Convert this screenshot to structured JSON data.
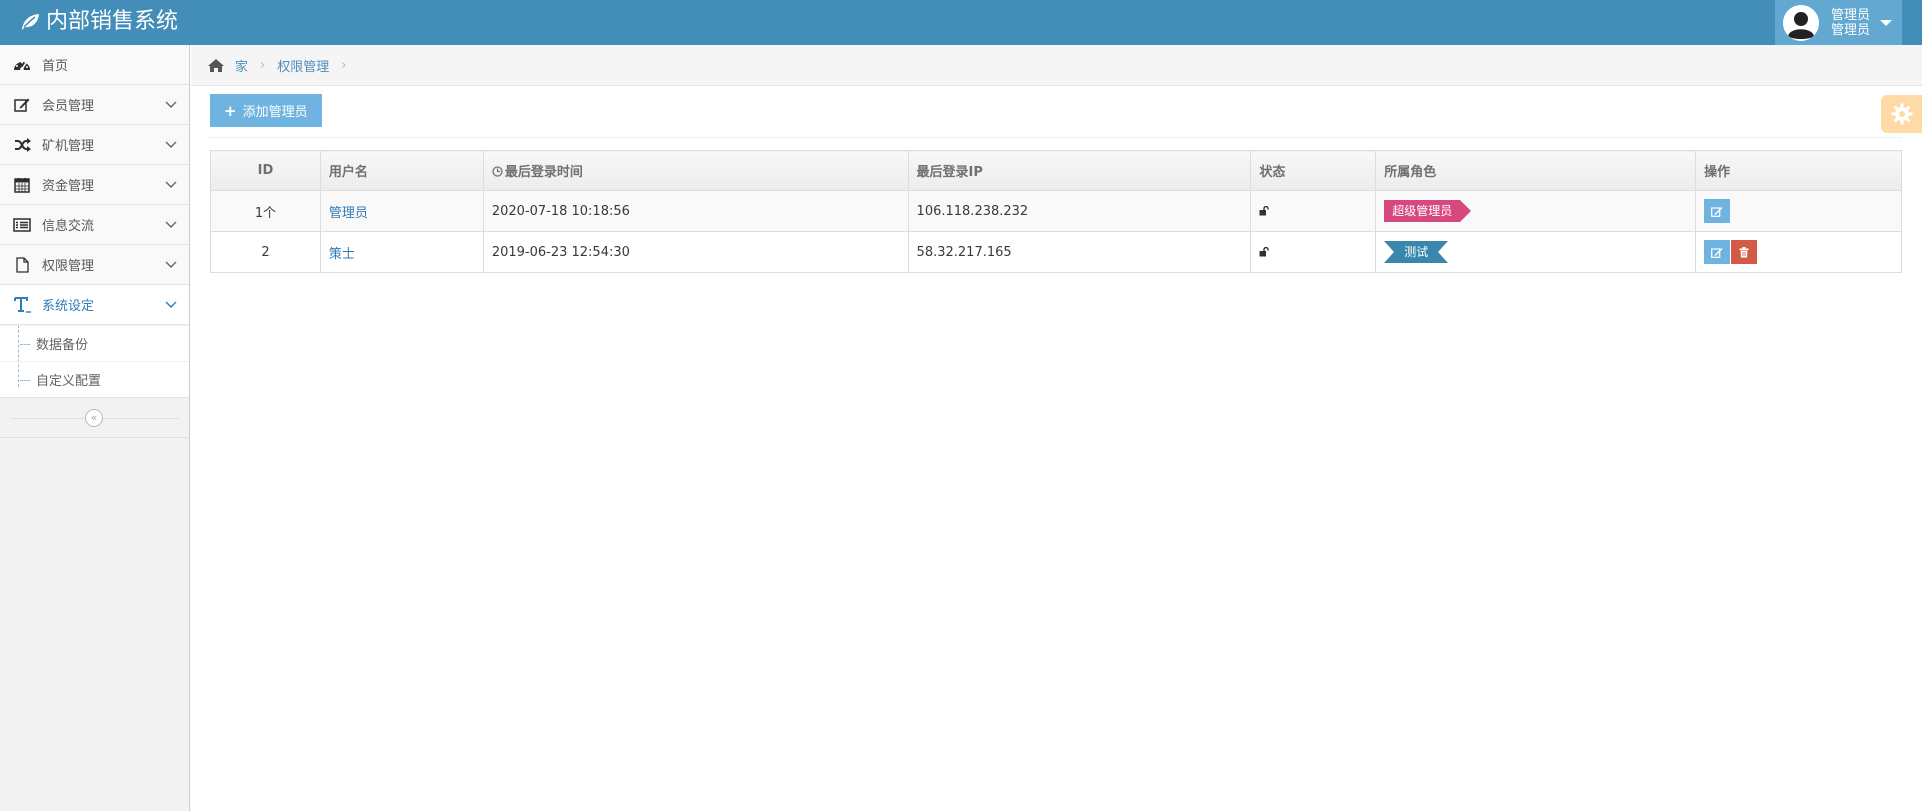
{
  "app": {
    "title": "内部销售系统"
  },
  "user": {
    "line1": "管理员",
    "line2": "管理员"
  },
  "sidebar": {
    "items": [
      {
        "label": "首页",
        "icon": "dashboard-icon"
      },
      {
        "label": "会员管理",
        "icon": "edit-icon"
      },
      {
        "label": "矿机管理",
        "icon": "random-icon"
      },
      {
        "label": "资金管理",
        "icon": "calendar-icon"
      },
      {
        "label": "信息交流",
        "icon": "list-alt-icon"
      },
      {
        "label": "权限管理",
        "icon": "file-icon"
      },
      {
        "label": "系统设定",
        "icon": "text-icon"
      }
    ],
    "submenu": [
      {
        "label": "数据备份"
      },
      {
        "label": "自定义配置"
      }
    ],
    "collapse_label": "«"
  },
  "breadcrumb": {
    "home": "家",
    "current": "权限管理",
    "sep": "›"
  },
  "toolbar": {
    "add_label": "添加管理员",
    "add_icon": "+"
  },
  "table": {
    "headers": [
      "ID",
      "用户名",
      "最后登录时间",
      "最后登录IP",
      "状态",
      "所属角色",
      "操作"
    ],
    "rows": [
      {
        "id": "1个",
        "username": "管理员",
        "last_login": "2020-07-18 10:18:56",
        "ip": "106.118.238.232",
        "status": "unlocked",
        "role": "超级管理员",
        "role_color": "#d6487e"
      },
      {
        "id": "2",
        "username": "策士",
        "last_login": "2019-06-23 12:54:30",
        "ip": "58.32.217.165",
        "status": "unlocked",
        "role": "测试",
        "role_color": "#3a87ad"
      }
    ]
  },
  "colors": {
    "navbar": "#438eb9",
    "accent": "#6fb3e0",
    "danger": "#d15b47",
    "settings": "#ffb752"
  }
}
